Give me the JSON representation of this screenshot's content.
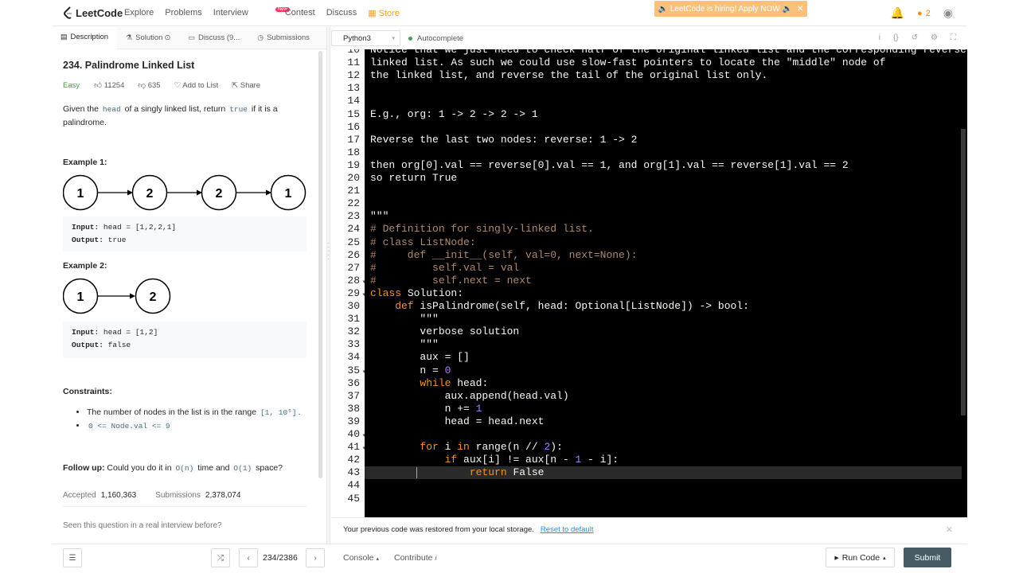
{
  "nav": {
    "logo": "LeetCode",
    "links": [
      "Explore",
      "Problems",
      "Interview",
      "Contest",
      "Discuss"
    ],
    "new_badge": "New",
    "store": "Store",
    "hiring": "🔈 LeetCode is hiring! Apply NOW 🔈",
    "streak": "2"
  },
  "tabs": [
    "Description",
    "Solution",
    "Discuss (9...",
    "Submissions"
  ],
  "problem": {
    "title": "234. Palindrome Linked List",
    "difficulty": "Easy",
    "likes": "11254",
    "dislikes": "635",
    "add_to_list": "Add to List",
    "share": "Share",
    "statement_pre": "Given the",
    "statement_head": "head",
    "statement_mid": "of a singly linked list, return",
    "statement_true": "true",
    "statement_post": "if it is a palindrome.",
    "ex1_title": "Example 1:",
    "ex1_nodes": [
      "1",
      "2",
      "2",
      "1"
    ],
    "ex1_input_label": "Input:",
    "ex1_input": "head = [1,2,2,1]",
    "ex1_output_label": "Output:",
    "ex1_output": "true",
    "ex2_title": "Example 2:",
    "ex2_nodes": [
      "1",
      "2"
    ],
    "ex2_input_label": "Input:",
    "ex2_input": "head = [1,2]",
    "ex2_output_label": "Output:",
    "ex2_output": "false",
    "constraints_title": "Constraints:",
    "constraint1_text": "The number of nodes in the list is in the range",
    "constraint1_code": "[1, 10⁵]",
    "constraint2_code": "0 <= Node.val <= 9",
    "followup_label": "Follow up:",
    "followup_pre": "Could you do it in",
    "followup_on": "O(n)",
    "followup_mid": "time and",
    "followup_o1": "O(1)",
    "followup_post": "space?",
    "accepted_label": "Accepted",
    "accepted": "1,160,363",
    "submissions_label": "Submissions",
    "submissions": "2,378,074",
    "interview_q": "Seen this question in a real interview before?"
  },
  "editor": {
    "language": "Python3",
    "autocomplete": "Autocomplete",
    "line_numbers": [
      "10",
      "11",
      "12",
      "13",
      "14",
      "15",
      "16",
      "17",
      "18",
      "19",
      "20",
      "21",
      "22",
      "23",
      "24",
      "25",
      "26",
      "27",
      "28",
      "29",
      "30",
      "31",
      "32",
      "33",
      "34",
      "35",
      "36",
      "37",
      "38",
      "39",
      "40",
      "41",
      "42",
      "43",
      "44",
      "45"
    ],
    "lines": [
      "Notice that we just need to check half of the original linked list and the corresponding reversed",
      "linked list. As such we could use slow-fast pointers to locate the \"middle\" node of",
      "the linked list, and reverse the tail of the original list only.",
      "",
      "",
      "E.g., org: 1 -> 2 -> 2 -> 1",
      "",
      "Reverse the last two nodes: reverse: 1 -> 2",
      "",
      "then org[0].val == reverse[0].val == 1, and org[1].val == reverse[1].val == 2",
      "so return True",
      "",
      "",
      "\"\"\"",
      "# Definition for singly-linked list.",
      "# class ListNode:",
      "#     def __init__(self, val=0, next=None):",
      "#         self.val = val",
      "#         self.next = next",
      "class Solution:",
      "    def isPalindrome(self, head: Optional[ListNode]) -> bool:",
      "        \"\"\"",
      "        verbose solution",
      "        \"\"\"",
      "        aux = []",
      "        n = 0",
      "        while head:",
      "            aux.append(head.val)",
      "            n += 1",
      "            head = head.next",
      "",
      "        for i in range(n // 2):",
      "            if aux[i] != aux[n - 1 - i]:",
      "                return False",
      "",
      ""
    ]
  },
  "notice": {
    "text": "Your previous code was restored from your local storage.",
    "reset": "Reset to default"
  },
  "bottom": {
    "pager": "234/2386",
    "console": "Console",
    "contribute": "Contribute",
    "run": "Run Code",
    "submit": "Submit"
  }
}
